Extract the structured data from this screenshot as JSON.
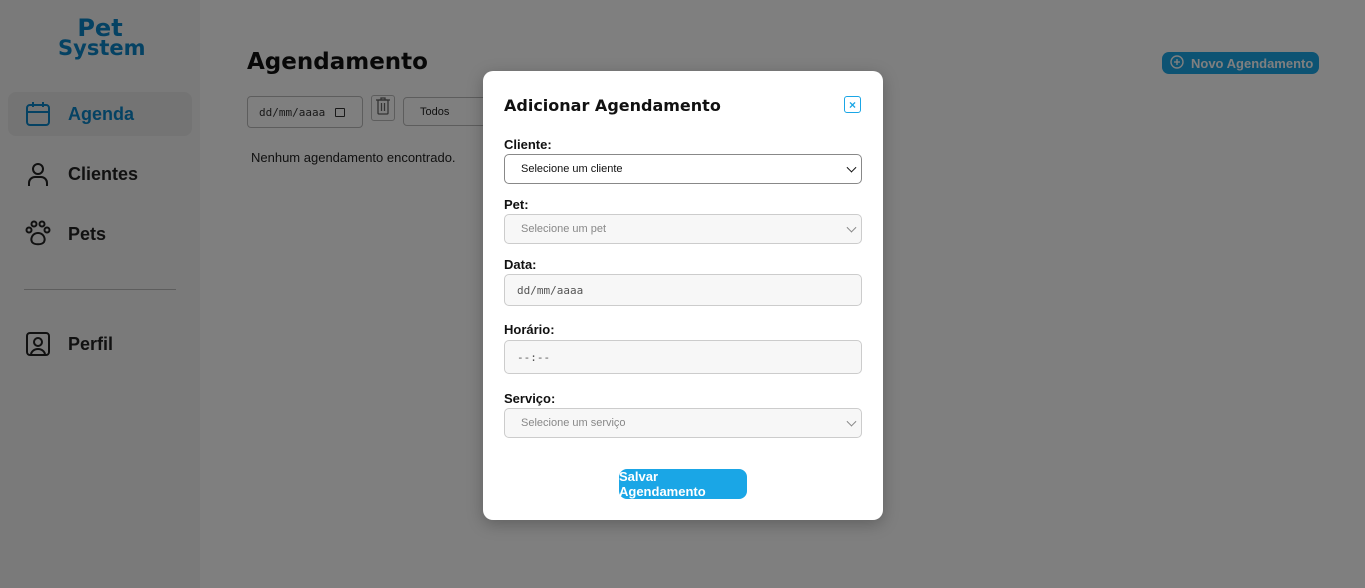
{
  "logo": {
    "line1": "Pet",
    "line2": "System"
  },
  "sidebar": {
    "items": [
      {
        "label": "Agenda",
        "icon": "calendar-icon",
        "active": true
      },
      {
        "label": "Clientes",
        "icon": "user-icon"
      },
      {
        "label": "Pets",
        "icon": "paw-icon"
      },
      {
        "label": "Perfil",
        "icon": "profile-icon"
      }
    ]
  },
  "main": {
    "title": "Agendamento",
    "new_button": "Novo Agendamento",
    "date_filter_value": "dd/mm/aaaa",
    "status_filter_value": "Todos",
    "empty_message": "Nenhum agendamento encontrado."
  },
  "modal": {
    "title": "Adicionar Agendamento",
    "fields": {
      "cliente": {
        "label": "Cliente:",
        "value": "Selecione um cliente"
      },
      "pet": {
        "label": "Pet:",
        "value": "Selecione um pet"
      },
      "data": {
        "label": "Data:",
        "value": "dd/mm/aaaa"
      },
      "horario": {
        "label": "Horário:",
        "value": "--:--"
      },
      "servico": {
        "label": "Serviço:",
        "value": "Selecione um serviço"
      }
    },
    "save_button": "Salvar Agendamento"
  },
  "colors": {
    "accent": "#1aa6e6",
    "brand": "#0a84c6",
    "overlay": "rgba(0,0,0,0.5)"
  }
}
